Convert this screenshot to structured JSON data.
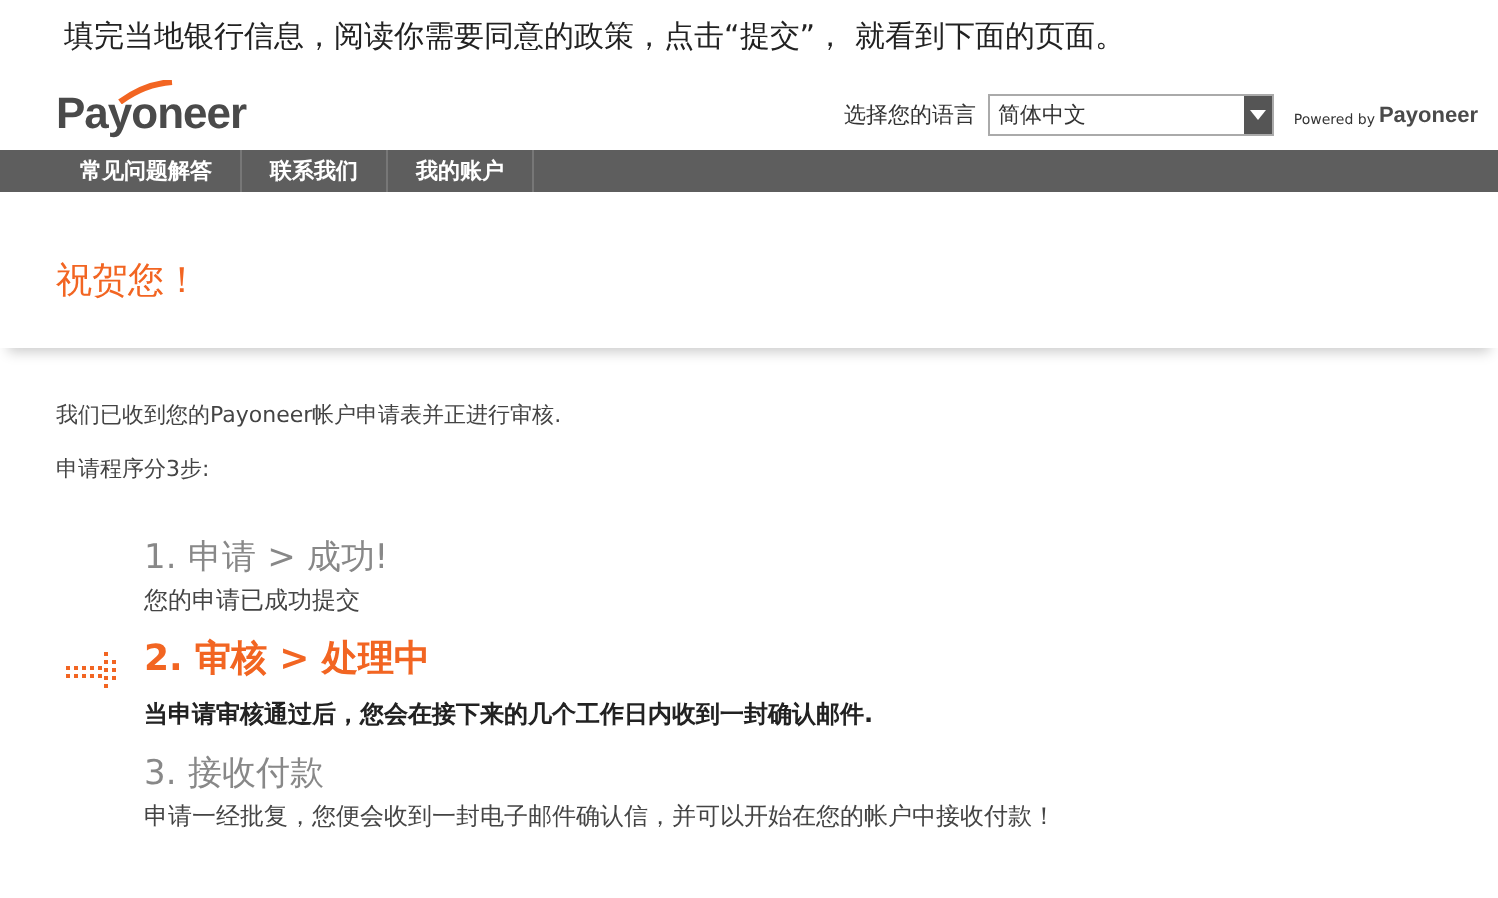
{
  "caption": "填完当地银行信息，阅读你需要同意的政策，点击“提交”， 就看到下面的页面。",
  "header": {
    "logo": "Payoneer",
    "language_label": "选择您的语言",
    "language": "简体中文",
    "powered_by": "Powered by",
    "powered_logo": "Payoneer"
  },
  "nav": [
    "常见问题解答",
    "联系我们",
    "我的账户"
  ],
  "heading": "祝贺您！",
  "intro": "我们已收到您的Payoneer帐户申请表并正进行审核.",
  "steps_label": "申请程序分3步:",
  "steps": [
    {
      "number": "1.",
      "title": "申请 > 成功!",
      "note": "您的申请已成功提交",
      "current": false
    },
    {
      "number": "2.",
      "title": "审核 > 处理中",
      "note": "当申请审核通过后，您会在接下来的几个工作日内收到一封确认邮件.",
      "current": true
    },
    {
      "number": "3.",
      "title": "接收付款",
      "note": "申请一经批复，您便会收到一封电子邮件确认信，并可以开始在您的帐户中接收付款！",
      "current": false
    }
  ]
}
